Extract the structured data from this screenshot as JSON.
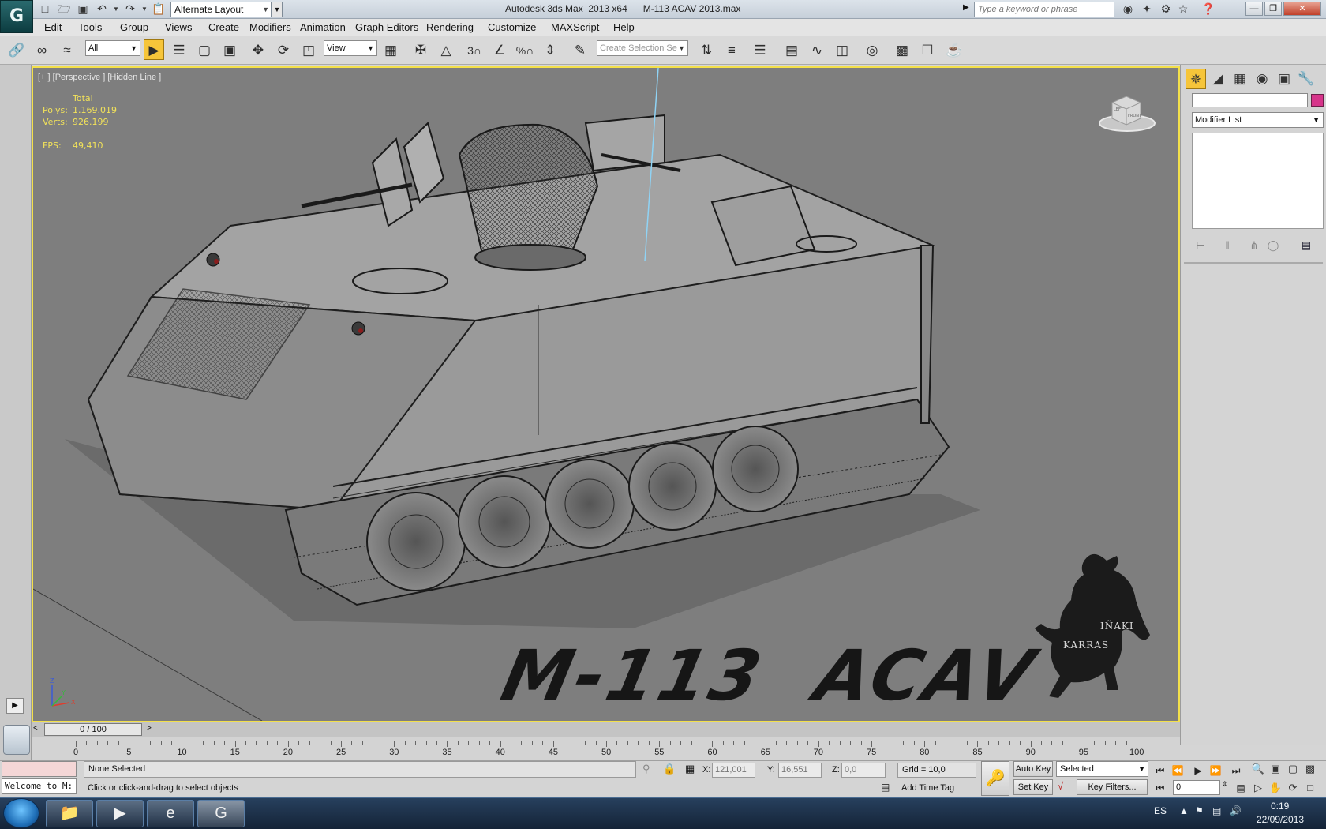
{
  "window": {
    "app_title": "Autodesk 3ds Max  2013 x64",
    "file_name": "M-113 ACAV 2013.max",
    "workspace": "Alternate Layout",
    "search_placeholder": "Type a keyword or phrase"
  },
  "menu": [
    "Edit",
    "Tools",
    "Group",
    "Views",
    "Create",
    "Modifiers",
    "Animation",
    "Graph Editors",
    "Rendering",
    "Customize",
    "MAXScript",
    "Help"
  ],
  "toolbar": {
    "filter": "All",
    "reference_coord": "View",
    "selection_set_placeholder": "Create Selection Se",
    "snap_angle_label": "3",
    "percent_label": "%"
  },
  "viewport": {
    "label": "[+ ] [Perspective ] [Hidden Line ]",
    "stats_header": "Total",
    "polys_label": "Polys:",
    "polys_value": "1.169.019",
    "verts_label": "Verts:",
    "verts_value": "926.199",
    "fps_label": "FPS:",
    "fps_value": "49,410",
    "banner_text": "M-113  ACAV",
    "logo_line1": "IÑAKI",
    "logo_line2": "KARRAS",
    "viewcube_labels": [
      "FRONT",
      "LEFT"
    ],
    "axes": [
      "X",
      "Y",
      "Z"
    ]
  },
  "command_panel": {
    "modifier_list": "Modifier List",
    "swatch_color": "#d6348a"
  },
  "timeline": {
    "position": "0 / 100",
    "ticks": [
      0,
      5,
      10,
      15,
      20,
      25,
      30,
      35,
      40,
      45,
      50,
      55,
      60,
      65,
      70,
      75,
      80,
      85,
      90,
      95,
      100
    ]
  },
  "status": {
    "maxscript_text": "Welcome to M:",
    "selection": "None Selected",
    "prompt": "Click or click-and-drag to select objects",
    "x_label": "X:",
    "x_value": "121,001",
    "y_label": "Y:",
    "y_value": "16,551",
    "z_label": "Z:",
    "z_value": "0,0",
    "grid": "Grid = 10,0",
    "add_time_tag": "Add Time Tag",
    "auto_key": "Auto Key",
    "set_key": "Set Key",
    "key_mode": "Selected",
    "key_filters": "Key Filters...",
    "frame": "0"
  },
  "taskbar": {
    "language": "ES",
    "time": "0:19",
    "date": "22/09/2013"
  }
}
